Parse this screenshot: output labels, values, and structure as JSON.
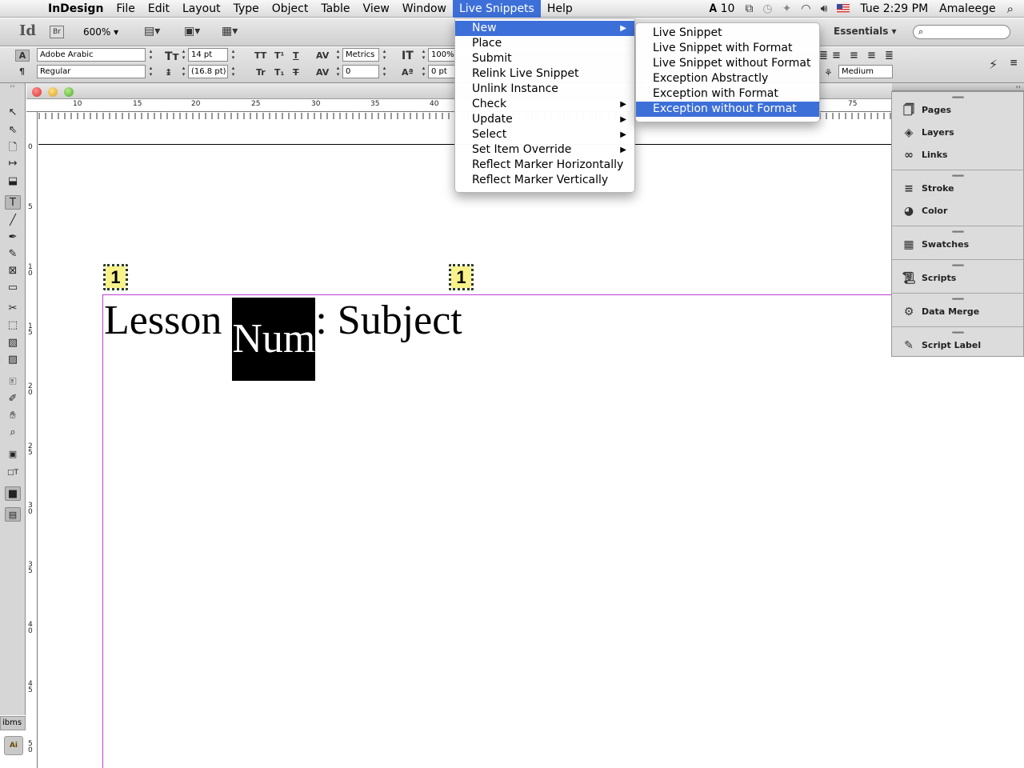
{
  "menubar": {
    "apple": "",
    "items": [
      {
        "label": "InDesign",
        "app": true
      },
      {
        "label": "File"
      },
      {
        "label": "Edit"
      },
      {
        "label": "Layout"
      },
      {
        "label": "Type"
      },
      {
        "label": "Object"
      },
      {
        "label": "Table"
      },
      {
        "label": "View"
      },
      {
        "label": "Window"
      },
      {
        "label": "Live Snippets",
        "open": true
      },
      {
        "label": "Help"
      }
    ],
    "status": {
      "adobe_count": "10",
      "clock": "Tue 2:29 PM",
      "user": "Amaleege"
    }
  },
  "appbar": {
    "logo": "Id",
    "bridge": "Br",
    "zoom": "600%",
    "workspace": "Essentials"
  },
  "control": {
    "font_family": "Adobe Arabic",
    "font_style": "Regular",
    "font_size": "14 pt",
    "leading": "(16.8 pt)",
    "kerning": "Metrics",
    "tracking": "0",
    "vertical_scale": "100%",
    "baseline_shift": "0 pt",
    "composer": "Medium"
  },
  "rulers": {
    "horizontal": [
      "10",
      "15",
      "20",
      "25",
      "30",
      "35",
      "40",
      "75"
    ],
    "vertical": [
      "0",
      "5",
      "1\n0",
      "1\n5",
      "2\n0",
      "2\n5",
      "3\n0",
      "3\n5",
      "4\n0",
      "4\n5",
      "5\n0"
    ]
  },
  "document": {
    "markers": [
      "1",
      "1"
    ],
    "headline_before": "Lesson ",
    "headline_selected": "Num",
    "headline_after": ": Subject"
  },
  "live_snippets_menu": {
    "items": [
      {
        "label": "New",
        "submenu": true,
        "highlighted": true
      },
      {
        "label": "Place"
      },
      {
        "label": "Submit"
      },
      {
        "label": "Relink Live Snippet"
      },
      {
        "label": "Unlink Instance"
      },
      {
        "label": "Check",
        "submenu": true
      },
      {
        "label": "Update",
        "submenu": true
      },
      {
        "label": "Select",
        "submenu": true
      },
      {
        "label": "Set Item Override",
        "submenu": true
      },
      {
        "label": "Reflect Marker Horizontally"
      },
      {
        "label": "Reflect Marker Vertically"
      }
    ],
    "submenu_new": [
      {
        "label": "Live Snippet"
      },
      {
        "label": "Live Snippet with Format"
      },
      {
        "label": "Live Snippet without Format"
      },
      {
        "label": "Exception Abstractly"
      },
      {
        "label": "Exception with Format"
      },
      {
        "label": "Exception without Format",
        "highlighted": true
      }
    ]
  },
  "panels": {
    "groups": [
      [
        {
          "label": "Pages",
          "icon": "pages-icon"
        },
        {
          "label": "Layers",
          "icon": "layers-icon"
        },
        {
          "label": "Links",
          "icon": "links-icon"
        }
      ],
      [
        {
          "label": "Stroke",
          "icon": "stroke-icon"
        },
        {
          "label": "Color",
          "icon": "color-icon"
        }
      ],
      [
        {
          "label": "Swatches",
          "icon": "swatches-icon"
        }
      ],
      [
        {
          "label": "Scripts",
          "icon": "scripts-icon"
        }
      ],
      [
        {
          "label": "Data Merge",
          "icon": "data-merge-icon"
        }
      ],
      [
        {
          "label": "Script Label",
          "icon": "script-label-icon"
        }
      ]
    ]
  },
  "taskbar": {
    "ibms": "ibms",
    "ai": "Ai"
  },
  "colors": {
    "menu_highlight": "#3d6fd8",
    "margin_guide": "#c13ad6",
    "marker_fill": "#f8f28a"
  }
}
